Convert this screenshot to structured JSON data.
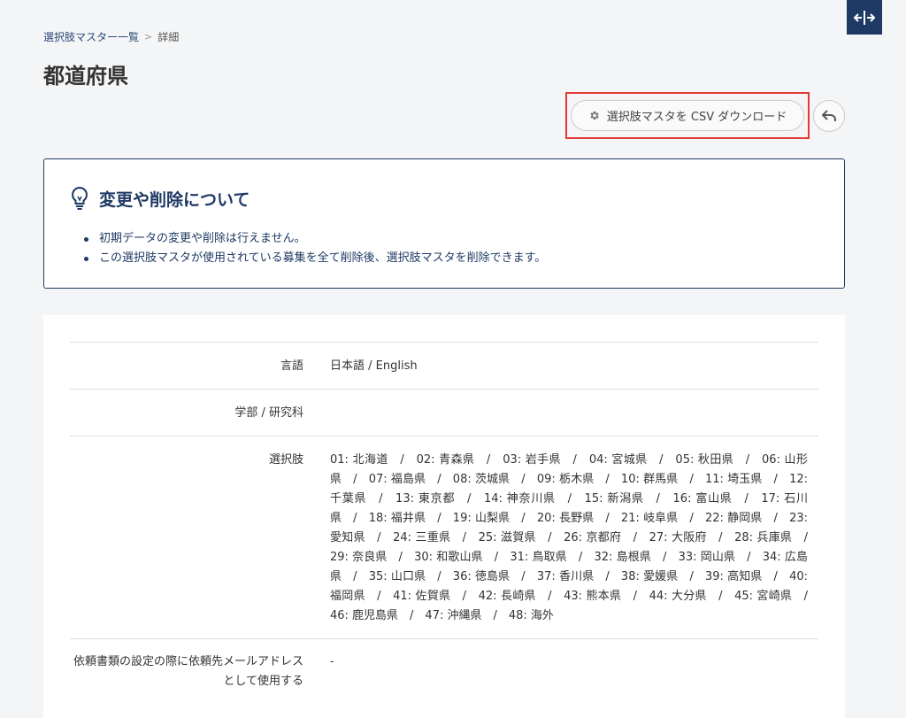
{
  "breadcrumb": {
    "parent": "選択肢マスター一覧",
    "separator": ">",
    "current": "詳細"
  },
  "page_title": "都道府県",
  "actions": {
    "csv_download_label": "選択肢マスタを CSV ダウンロード"
  },
  "notice": {
    "title": "変更や削除について",
    "items": [
      "初期データの変更や削除は行えません。",
      "この選択肢マスタが使用されている募集を全て削除後、選択肢マスタを削除できます。"
    ]
  },
  "details": [
    {
      "label": "言語",
      "value": "日本語 / English"
    },
    {
      "label": "学部 / 研究科",
      "value": ""
    },
    {
      "label": "選択肢",
      "value": "01: 北海道　/　02: 青森県　/　03: 岩手県　/　04: 宮城県　/　05: 秋田県　/　06: 山形県　/　07: 福島県　/　08: 茨城県　/　09: 栃木県　/　10: 群馬県　/　11: 埼玉県　/　12: 千葉県　/　13: 東京都　/　14: 神奈川県　/　15: 新潟県　/　16: 富山県　/　17: 石川県　/　18: 福井県　/　19: 山梨県　/　20: 長野県　/　21: 岐阜県　/　22: 静岡県　/　23: 愛知県　/　24: 三重県　/　25: 滋賀県　/　26: 京都府　/　27: 大阪府　/　28: 兵庫県　/　29: 奈良県　/　30: 和歌山県　/　31: 鳥取県　/　32: 島根県　/　33: 岡山県　/　34: 広島県　/　35: 山口県　/　36: 徳島県　/　37: 香川県　/　38: 愛媛県　/　39: 高知県　/　40: 福岡県　/　41: 佐賀県　/　42: 長崎県　/　43: 熊本県　/　44: 大分県　/　45: 宮崎県　/　46: 鹿児島県　/　47: 沖縄県　/　48: 海外"
    },
    {
      "label": "依頼書類の設定の際に依頼先メールアドレスとして使用する",
      "value": "-"
    }
  ]
}
